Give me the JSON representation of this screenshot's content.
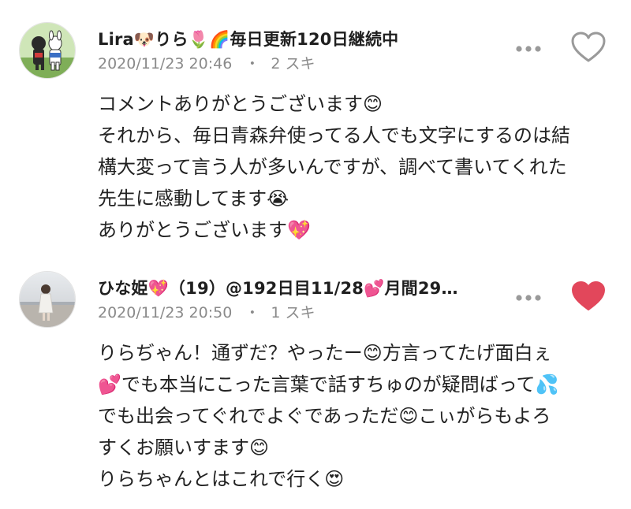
{
  "comments": [
    {
      "author": "Lira🐶りら🌷🌈毎日更新120日継続中",
      "timestamp": "2020/11/23 20:46",
      "separator": "・",
      "likes": "2 スキ",
      "liked": false,
      "lines": [
        "コメントありがとうございます😊",
        "それから、毎日青森弁使ってる人でも文字にするのは結",
        "構大変って言う人が多いんですが、調べて書いてくれた",
        "先生に感動してます😭",
        "ありがとうございます💖"
      ]
    },
    {
      "author": "ひな姫💖（19）@192日目11/28💕月間29…",
      "timestamp": "2020/11/23 20:50",
      "separator": "・",
      "likes": "1 スキ",
      "liked": true,
      "lines": [
        "りらぢゃん！通ずだ？やったー😊方言ってたげ面白ぇ",
        "💕でも本当にこった言葉で話すちゅのが疑問ばって💦",
        "でも出会ってぐれでよぐであっただ😊こぃがらもよろ",
        "すくお願いすます😊",
        "りらちゃんとはこれで行く😍"
      ]
    }
  ],
  "icons": {
    "more": "more-dots-icon",
    "like_outline": "heart-outline-icon",
    "like_filled": "heart-filled-icon"
  },
  "colors": {
    "heart_filled": "#e2475b",
    "heart_outline": "#9a9a9a",
    "meta_text": "#8a8a8a"
  }
}
